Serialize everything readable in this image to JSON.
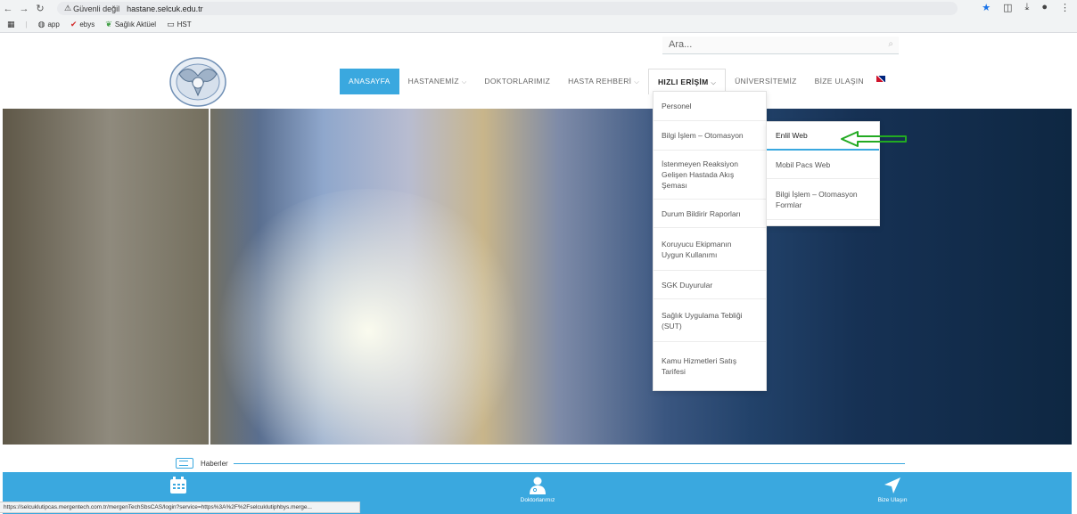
{
  "browser": {
    "security_label": "Güvenli değil",
    "url": "hastane.selcuk.edu.tr",
    "bookmarks": [
      {
        "label": "app",
        "icon": "globe-icon"
      },
      {
        "label": "ebys",
        "icon": "check-icon"
      },
      {
        "label": "Sağlık Aktüel",
        "icon": "leaf-icon"
      },
      {
        "label": "HST",
        "icon": "folder-icon"
      }
    ],
    "status_url": "https://selcuklutipcas.mergentech.com.tr/mergenTechSbsCAS/login?service=https%3A%2F%2Fselcuklutiphbys.merge..."
  },
  "site": {
    "search_placeholder": "Ara...",
    "menu": [
      {
        "label": "ANASAYFA"
      },
      {
        "label": "HASTANEMİZ"
      },
      {
        "label": "DOKTORLARIMIZ"
      },
      {
        "label": "HASTA REHBERİ"
      },
      {
        "label": "HIZLI ERİŞİM"
      },
      {
        "label": "ÜNİVERSİTEMİZ"
      },
      {
        "label": "BİZE ULAŞIN"
      }
    ],
    "quick_access": [
      "Personel",
      "Bilgi İşlem – Otomasyon",
      "İstenmeyen Reaksiyon\nGelişen Hastada Akış\nŞeması",
      "Durum Bildirir Raporları",
      "Koruyucu Ekipmanın\nUygun Kullanımı",
      "SGK Duyurular",
      "Sağlık Uygulama Tebliği\n(SUT)",
      "Kamu Hizmetleri Satış\nTarifesi"
    ],
    "submenu": [
      "Enlil Web",
      "Mobil Pacs Web",
      "Bilgi İşlem – Otomasyon\nFormlar"
    ],
    "news_label": "Haberler",
    "bottom_bar": [
      {
        "label": "",
        "icon": "calendar-icon"
      },
      {
        "label": "Doktorlarımız",
        "icon": "doctors-icon"
      },
      {
        "label": "Bize Ulaşın",
        "icon": "location-arrow-icon"
      }
    ],
    "accent_color": "#3aa8df",
    "annotation_arrow_color": "#22aa22"
  }
}
